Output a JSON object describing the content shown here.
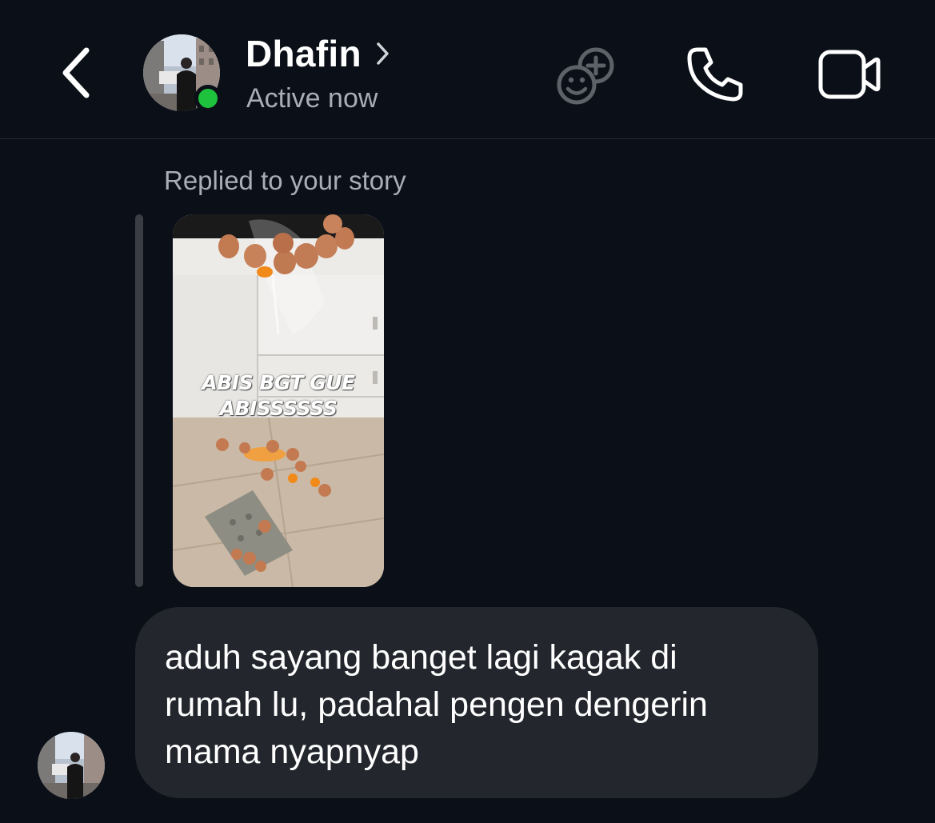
{
  "header": {
    "contact_name": "Dhafin",
    "status": "Active now",
    "online": true,
    "icons": [
      "chevron-left-icon",
      "chevron-right-icon",
      "effects-icon",
      "phone-icon",
      "video-camera-icon"
    ]
  },
  "thread": {
    "reply_label": "Replied to your story",
    "story": {
      "caption_lines": [
        "ABIS BGT GUE",
        "ABISSSSSS"
      ]
    },
    "message": {
      "lines": [
        "aduh sayang banget lagi kagak di",
        "rumah lu, padahal pengen dengerin",
        "mama nyapnyap"
      ]
    }
  },
  "colors": {
    "background": "#0b0f17",
    "bubble": "#23262d",
    "secondary_text": "#a9adb6",
    "online": "#1ec23d",
    "divider": "#262a33"
  }
}
